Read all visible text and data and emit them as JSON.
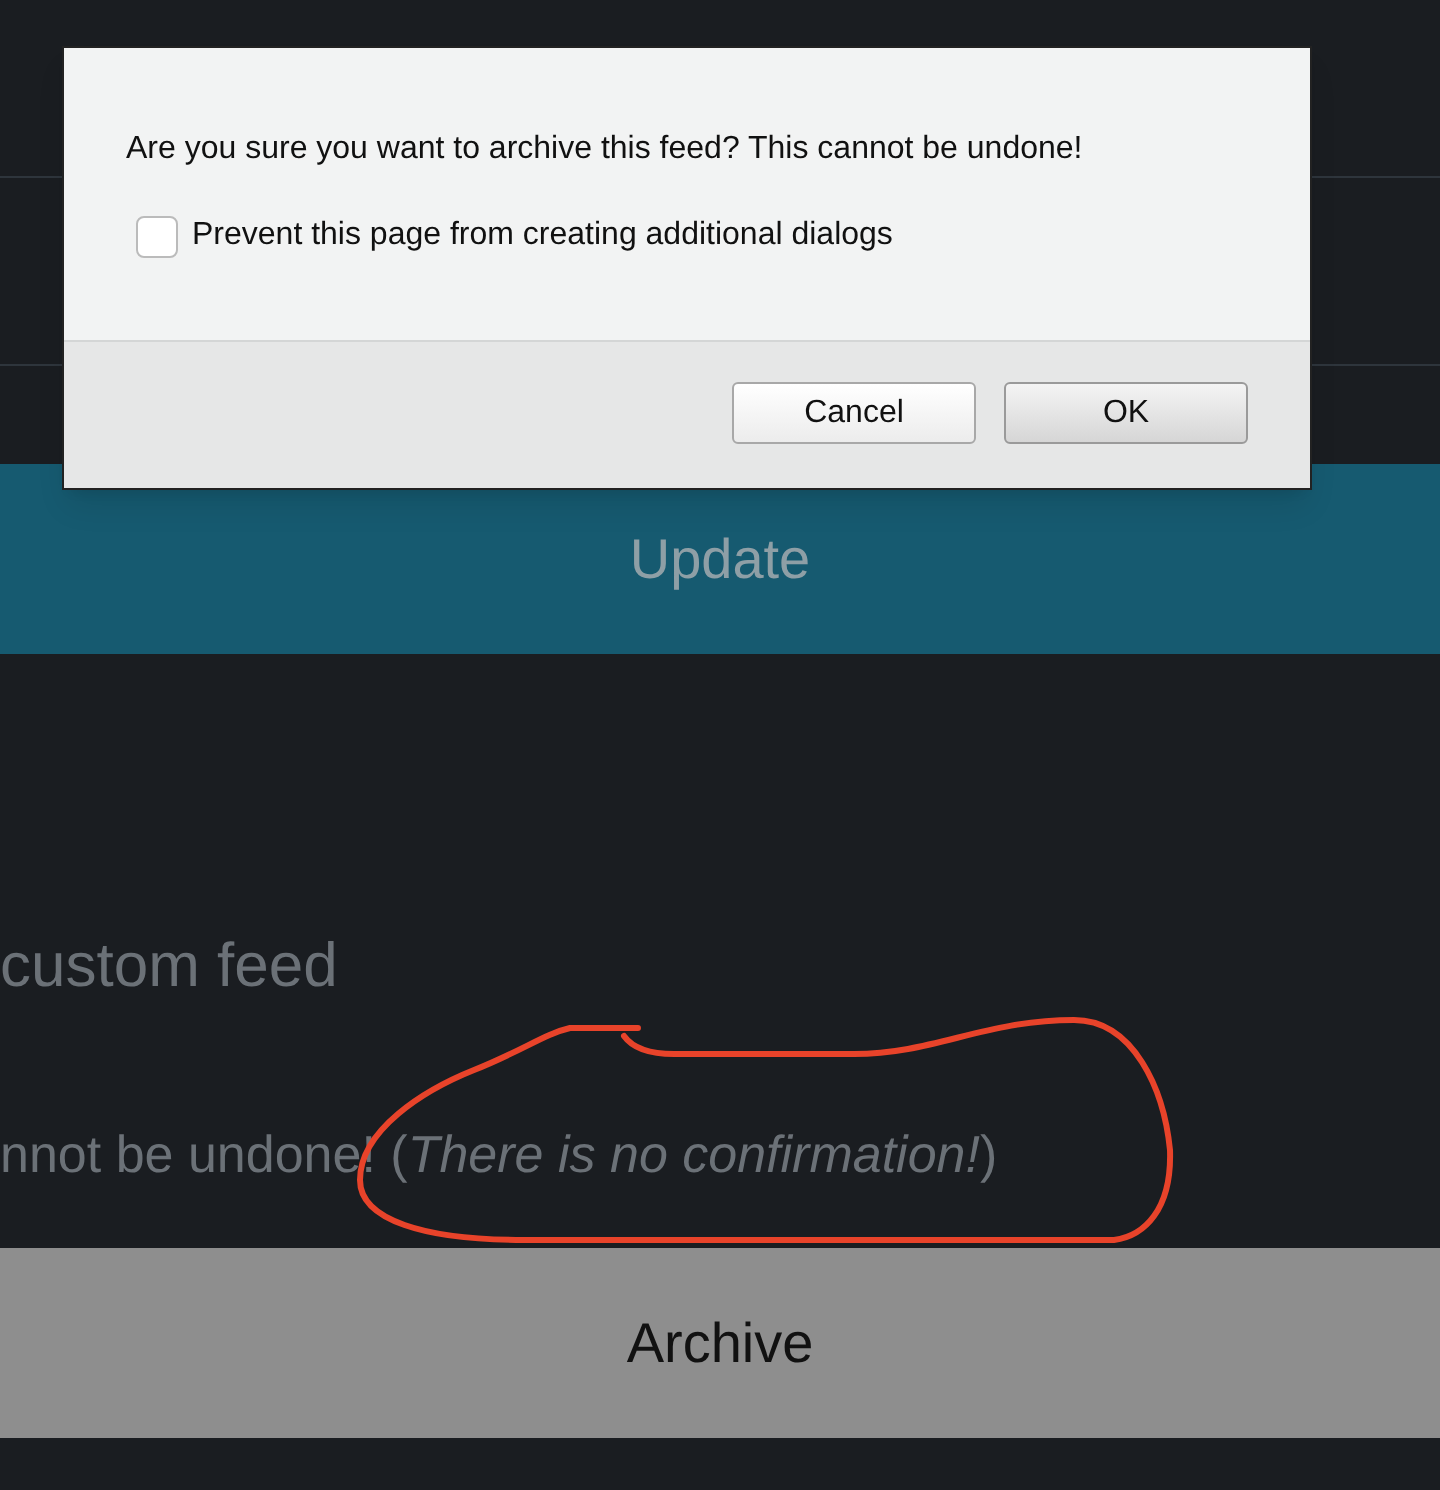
{
  "dialog": {
    "message": "Are you sure you want to archive this feed? This cannot be undone!",
    "checkbox": {
      "label": "Prevent this page from creating additional dialogs",
      "checked": false
    },
    "buttons": [
      {
        "label": "Cancel",
        "default": false
      },
      {
        "label": "OK",
        "default": true
      }
    ]
  },
  "page": {
    "update_button": "Update",
    "heading": "custom feed",
    "warning": "nnot be undone! (*There is no confirmation!*)",
    "archive_button": "Archive"
  }
}
